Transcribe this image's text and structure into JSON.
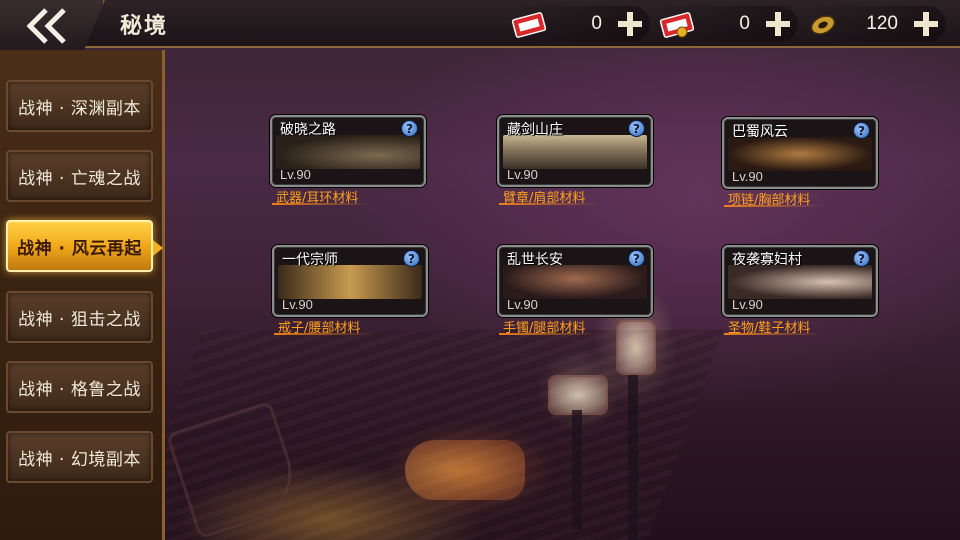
{
  "header": {
    "title": "秘境"
  },
  "currencies": [
    {
      "icon": "ticket-icon",
      "value": "0"
    },
    {
      "icon": "gold-ticket-icon",
      "value": "0"
    },
    {
      "icon": "coin-icon",
      "value": "120"
    }
  ],
  "sidebar": {
    "items": [
      {
        "label": "战神 · 深渊副本",
        "active": false
      },
      {
        "label": "战神 · 亡魂之战",
        "active": false
      },
      {
        "label": "战神 · 风云再起",
        "active": true
      },
      {
        "label": "战神 · 狙击之战",
        "active": false
      },
      {
        "label": "战神 · 格鲁之战",
        "active": false
      },
      {
        "label": "战神 · 幻境副本",
        "active": false
      }
    ]
  },
  "dungeons": [
    {
      "name": "破晓之路",
      "level": "Lv.90",
      "materials": "武器/耳环材料",
      "help": "?"
    },
    {
      "name": "藏剑山庄",
      "level": "Lv.90",
      "materials": "臂章/肩部材料",
      "help": "?"
    },
    {
      "name": "巴蜀风云",
      "level": "Lv.90",
      "materials": "项链/胸部材料",
      "help": "?"
    },
    {
      "name": "一代宗师",
      "level": "Lv.90",
      "materials": "戒子/腰部材料",
      "help": "?"
    },
    {
      "name": "乱世长安",
      "level": "Lv.90",
      "materials": "手镯/腿部材料",
      "help": "?"
    },
    {
      "name": "夜袭寡妇村",
      "level": "Lv.90",
      "materials": "圣物/鞋子材料",
      "help": "?"
    }
  ],
  "colors": {
    "accent": "#ffa21a",
    "active_tab": "#f0a818",
    "frame": "#8a6030"
  }
}
